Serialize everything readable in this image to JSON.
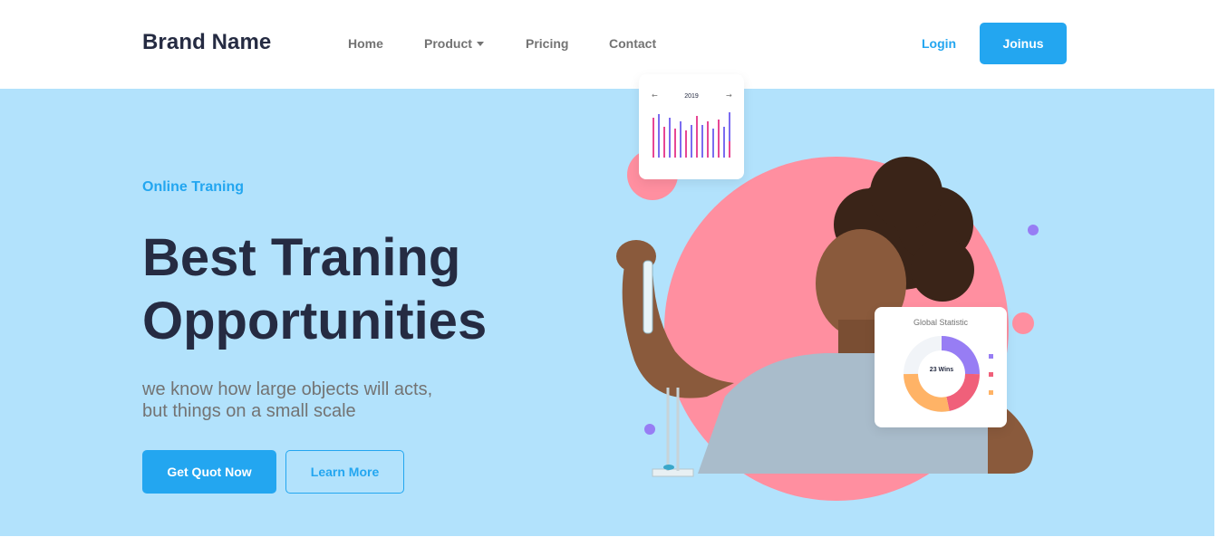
{
  "nav": {
    "brand": "Brand Name",
    "links": [
      "Home",
      "Product",
      "Pricing",
      "Contact"
    ],
    "login": "Login",
    "join": "Joinus"
  },
  "hero": {
    "eyebrow": "Online Traning",
    "headline_line1": "Best Traning",
    "headline_line2": "Opportunities",
    "subtitle_line1": "we know how large objects will acts,",
    "subtitle_line2": "but things on a small scale",
    "primary_button": "Get Quot Now",
    "secondary_button": "Learn More"
  },
  "chart_card": {
    "year": "2019",
    "prev_arrow": "←",
    "next_arrow": "→"
  },
  "stat_card": {
    "title": "Global Statistic",
    "center_label": "23 Wins"
  },
  "colors": {
    "primary": "#23a6f0",
    "dark": "#252b42",
    "muted": "#737373",
    "hero_bg": "#b2e2fc",
    "pink_circle": "#ff8fa0",
    "purple_dot": "#977df4"
  }
}
